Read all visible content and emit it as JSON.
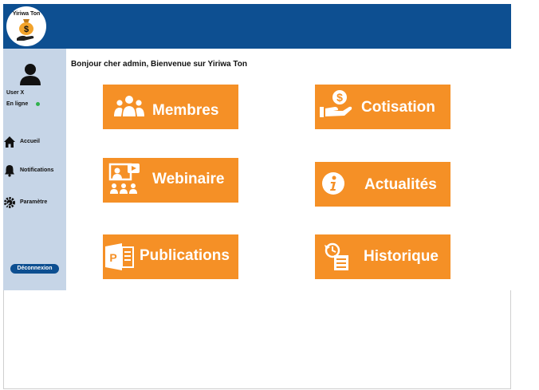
{
  "app": {
    "logo_text": "Yiriwa Ton"
  },
  "sidebar": {
    "user_name": "User X",
    "user_status": "En ligne",
    "items": [
      {
        "label": "Accueil",
        "icon": "home-icon"
      },
      {
        "label": "Notifications",
        "icon": "bell-icon"
      },
      {
        "label": "Paramètre",
        "icon": "settings-icon"
      }
    ],
    "logout_label": "Déconnexion"
  },
  "main": {
    "greeting": "Bonjour cher admin, Bienvenue sur Yiriwa Ton",
    "tiles": [
      {
        "label": "Membres",
        "icon": "members-icon"
      },
      {
        "label": "Cotisation",
        "icon": "contribution-icon"
      },
      {
        "label": "Webinaire",
        "icon": "webinar-icon"
      },
      {
        "label": "Actualités",
        "icon": "info-icon"
      },
      {
        "label": "Publications",
        "icon": "powerpoint-icon"
      },
      {
        "label": "Historique",
        "icon": "history-icon"
      }
    ]
  },
  "colors": {
    "header": "#0d4f91",
    "sidebar": "#c6d5e7",
    "tile": "#f59026",
    "status_online": "#2fb14c"
  }
}
